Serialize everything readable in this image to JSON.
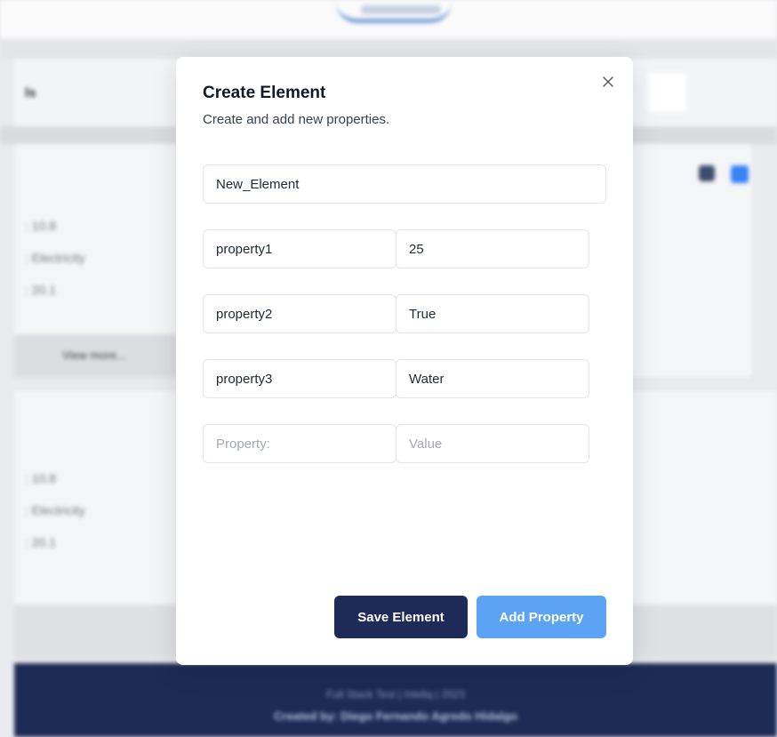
{
  "background": {
    "nav_text": "ls",
    "card1_lines": [
      ": 10.8",
      ": Electricity",
      ": 20.1"
    ],
    "view_more": "View more...",
    "card2_lines": [
      ": 10.8",
      ": Electricity",
      ": 20.1"
    ],
    "footer_line1": "Full Stack Test | Inteliq | 2023",
    "footer_line2": "Created by: Diego Fernando Agredo Hidalgo"
  },
  "modal": {
    "title": "Create Element",
    "subtitle": "Create and add new properties.",
    "close_icon": "close-icon",
    "element_name": "New_Element",
    "properties": [
      {
        "name": "property1",
        "value": "25"
      },
      {
        "name": "property2",
        "value": "True"
      },
      {
        "name": "property3",
        "value": "Water"
      }
    ],
    "new_property_placeholder": "Property:",
    "new_value_placeholder": "Value",
    "save_label": "Save Element",
    "add_label": "Add Property"
  },
  "colors": {
    "primary_dark": "#1e2a57",
    "primary_light": "#5ca3f4"
  }
}
